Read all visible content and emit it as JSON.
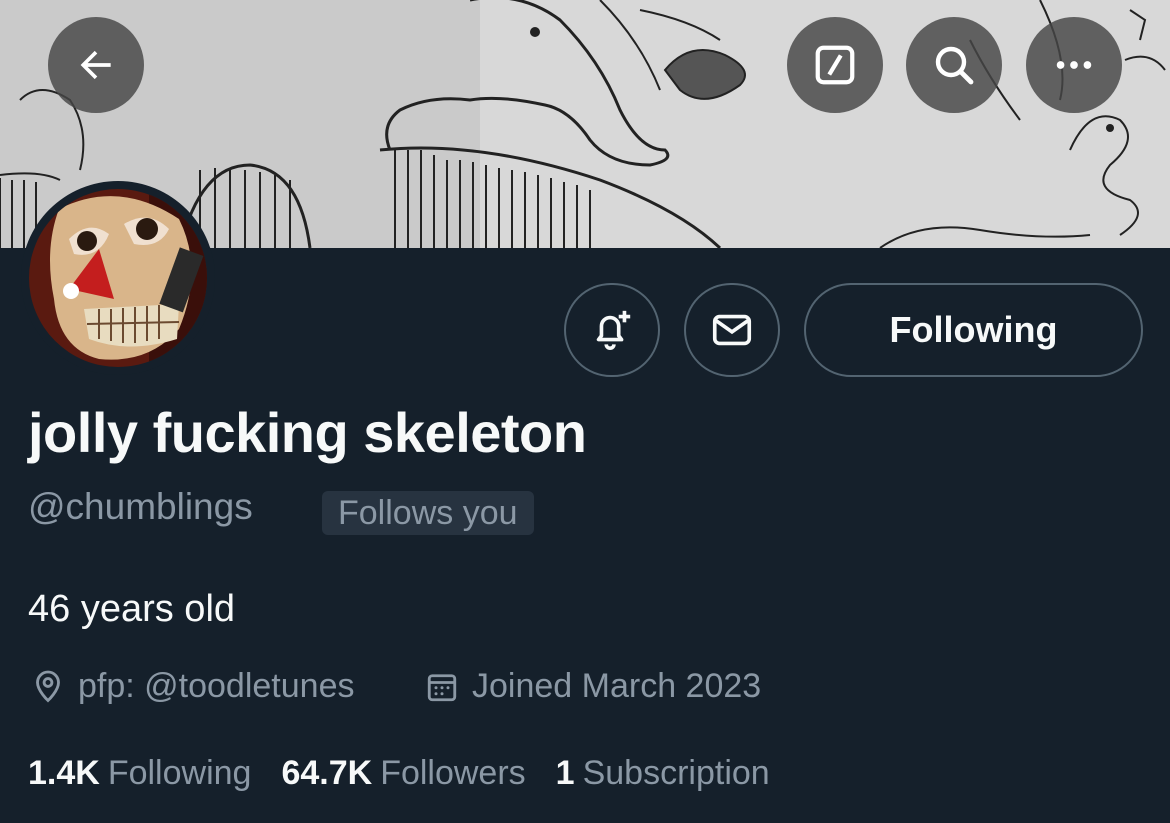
{
  "profile": {
    "display_name": "jolly fucking skeleton",
    "handle": "@chumblings",
    "follows_you": "Follows you",
    "bio": "46 years old",
    "location": "pfp: @toodletunes",
    "joined": "Joined March 2023",
    "following_btn": "Following"
  },
  "stats": [
    {
      "num": "1.4K",
      "label": "Following"
    },
    {
      "num": "64.7K",
      "label": "Followers"
    },
    {
      "num": "1",
      "label": "Subscription"
    }
  ],
  "icons": {
    "back": "arrow-left-icon",
    "compose": "compose-icon",
    "search": "search-icon",
    "more": "more-icon",
    "notify": "bell-plus-icon",
    "message": "envelope-icon",
    "location": "location-pin-icon",
    "calendar": "calendar-icon"
  },
  "colors": {
    "background": "#15202b",
    "secondary_text": "#8b98a5",
    "border": "#536471"
  }
}
